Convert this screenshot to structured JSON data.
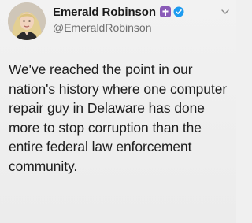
{
  "tweet": {
    "author": {
      "display_name": "Emerald Robinson",
      "handle": "@EmeraldRobinson",
      "avatar_icon": "profile-photo",
      "badges": [
        "cross-icon",
        "verified-icon"
      ]
    },
    "menu_icon": "chevron-down-icon",
    "text": "We've reached the point in our nation's history where one computer repair guy in Delaware has done more to stop corruption than the entire federal law enforcement community.",
    "colors": {
      "cross_badge": "#8a5bb8",
      "verified": "#1d9bf0"
    }
  }
}
